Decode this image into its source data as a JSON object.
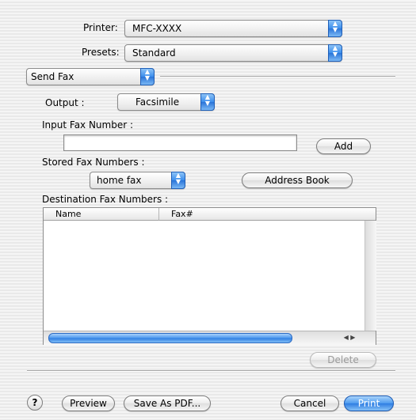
{
  "printer": {
    "label": "Printer:",
    "value": "MFC-XXXX"
  },
  "presets": {
    "label": "Presets:",
    "value": "Standard"
  },
  "pane": {
    "value": "Send Fax"
  },
  "output": {
    "label": "Output :",
    "value": "Facsimile"
  },
  "input_fax": {
    "label": "Input Fax Number :",
    "value": "",
    "add_label": "Add"
  },
  "stored": {
    "label": "Stored Fax Numbers :",
    "value": "home fax",
    "address_book_label": "Address Book"
  },
  "destination": {
    "label": "Destination Fax Numbers :",
    "columns": [
      "Name",
      "Fax#"
    ],
    "rows": [],
    "delete_label": "Delete"
  },
  "footer": {
    "help_label": "?",
    "preview_label": "Preview",
    "save_pdf_label": "Save As PDF...",
    "cancel_label": "Cancel",
    "print_label": "Print"
  },
  "colors": {
    "accent": "#3a8ded",
    "default_button": "#2e7de2"
  }
}
